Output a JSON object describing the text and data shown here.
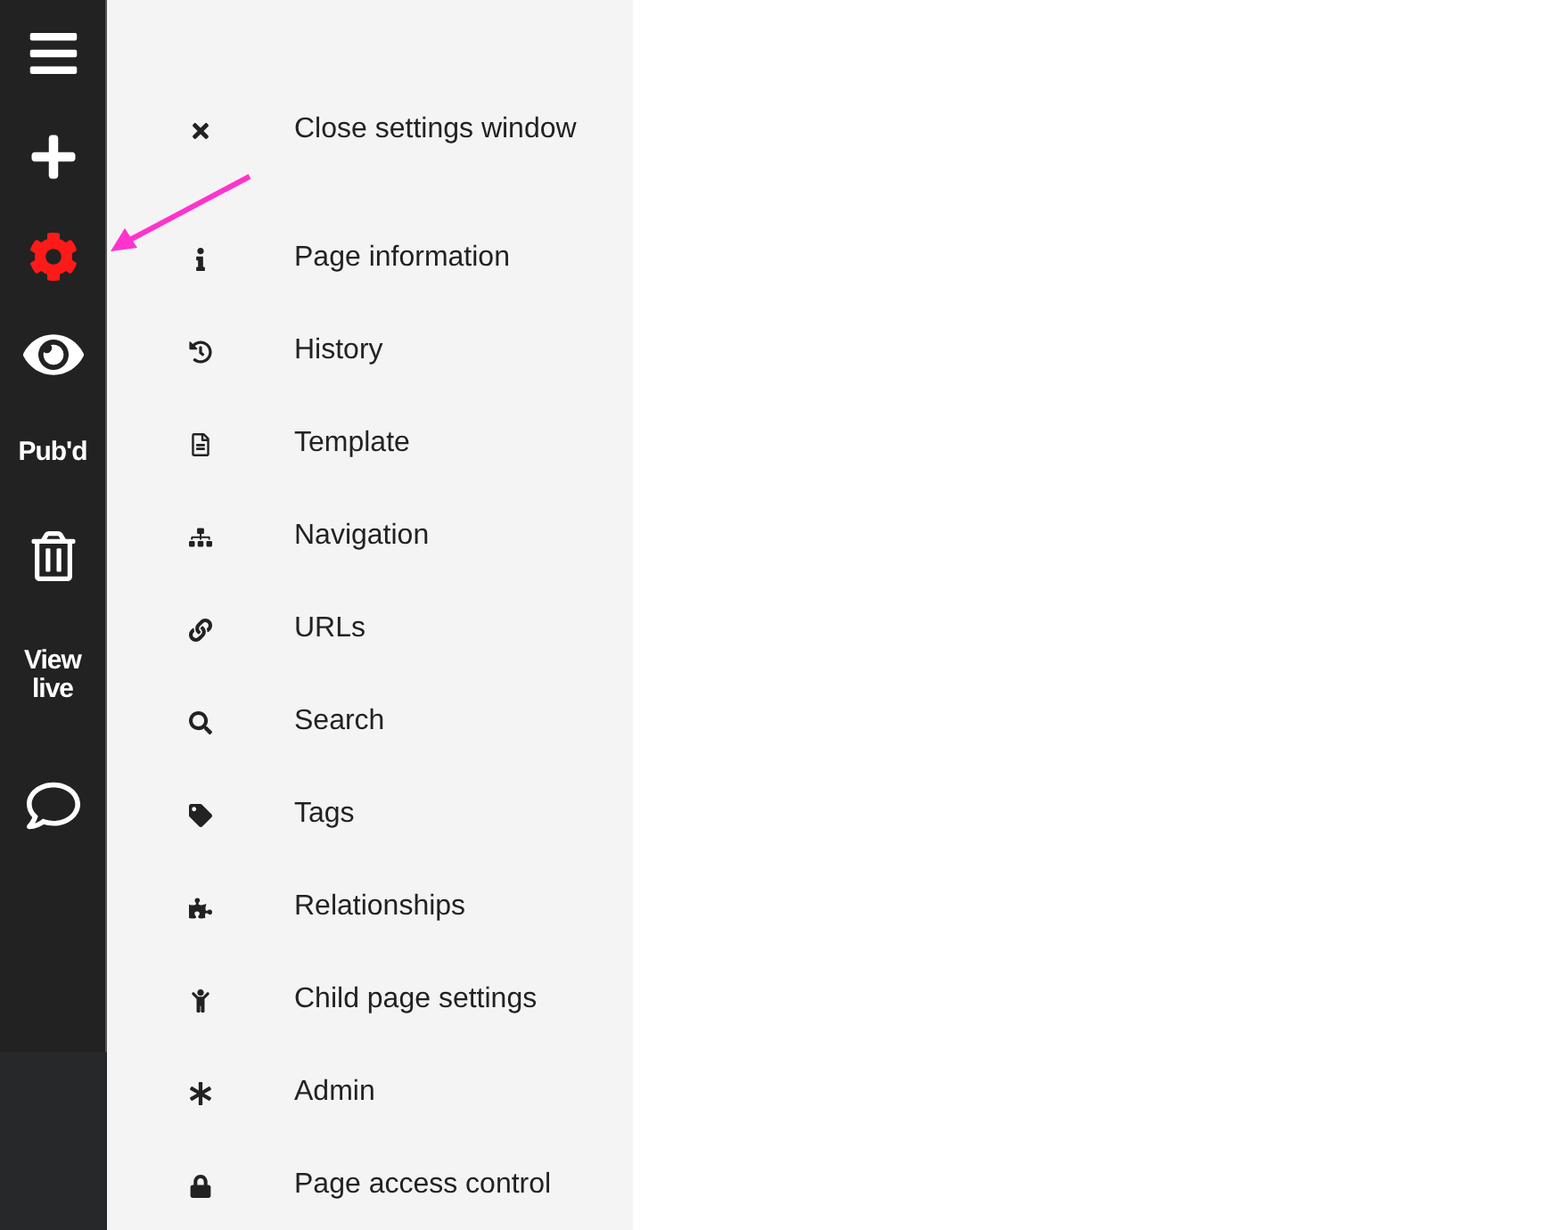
{
  "sidebar": {
    "items": [
      {
        "kind": "icon",
        "selected": false
      },
      {
        "kind": "icon",
        "selected": false
      },
      {
        "kind": "icon",
        "selected": true
      },
      {
        "kind": "icon",
        "selected": false
      },
      {
        "kind": "label",
        "label": "Pub'd",
        "selected": false
      },
      {
        "kind": "icon",
        "selected": false
      },
      {
        "kind": "label",
        "label": "View live",
        "selected": false
      },
      {
        "kind": "icon",
        "selected": false
      }
    ]
  },
  "settings_menu": {
    "items": [
      {
        "label": "Close settings window"
      },
      {
        "label": "Page information"
      },
      {
        "label": "History"
      },
      {
        "label": "Template"
      },
      {
        "label": "Navigation"
      },
      {
        "label": "URLs"
      },
      {
        "label": "Search"
      },
      {
        "label": "Tags"
      },
      {
        "label": "Relationships"
      },
      {
        "label": "Child page settings"
      },
      {
        "label": "Admin"
      },
      {
        "label": "Page access control"
      }
    ]
  }
}
